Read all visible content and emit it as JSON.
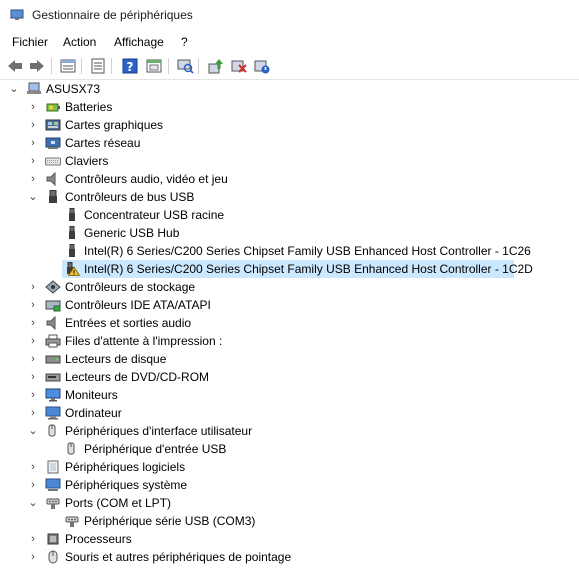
{
  "window": {
    "title": "Gestionnaire de périphériques"
  },
  "menu": [
    "Fichier",
    "Action",
    "Affichage",
    "?"
  ],
  "toolbar": {
    "buttons": [
      "back-icon",
      "forward-icon",
      "properties-view-icon",
      "list-view-icon",
      "help-icon",
      "show-hidden-icon",
      "scan-icon",
      "update-driver-icon",
      "uninstall-icon",
      "disable-device-icon"
    ]
  },
  "colors": {
    "selection": "#cce8ff",
    "warning": "#f2c12e"
  },
  "tree": {
    "root": "ASUSX73",
    "nodes": [
      {
        "label": "Batteries",
        "state": "collapsed",
        "icon": "battery-icon"
      },
      {
        "label": "Cartes graphiques",
        "state": "collapsed",
        "icon": "display-adapter-icon"
      },
      {
        "label": "Cartes réseau",
        "state": "collapsed",
        "icon": "network-adapter-icon"
      },
      {
        "label": "Claviers",
        "state": "collapsed",
        "icon": "keyboard-icon"
      },
      {
        "label": "Contrôleurs audio, vidéo et jeu",
        "state": "collapsed",
        "icon": "speaker-icon"
      },
      {
        "label": "Contrôleurs de bus USB",
        "state": "expanded",
        "icon": "usb-icon",
        "children": [
          {
            "label": "Concentrateur USB racine",
            "icon": "usb-plug-icon"
          },
          {
            "label": "Generic USB Hub",
            "icon": "usb-plug-icon"
          },
          {
            "label": "Intel(R) 6 Series/C200 Series Chipset Family USB Enhanced Host Controller - 1C26",
            "icon": "usb-plug-icon"
          },
          {
            "label": "Intel(R) 6 Series/C200 Series Chipset Family USB Enhanced Host Controller - 1C2D",
            "icon": "usb-warning-icon",
            "selected": true
          }
        ]
      },
      {
        "label": "Contrôleurs de stockage",
        "state": "collapsed",
        "icon": "storage-controller-icon"
      },
      {
        "label": "Contrôleurs IDE ATA/ATAPI",
        "state": "collapsed",
        "icon": "ide-controller-icon"
      },
      {
        "label": "Entrées et sorties audio",
        "state": "collapsed",
        "icon": "audio-io-icon"
      },
      {
        "label": "Files d'attente à l'impression :",
        "state": "collapsed",
        "icon": "printer-icon"
      },
      {
        "label": "Lecteurs de disque",
        "state": "collapsed",
        "icon": "disk-drive-icon"
      },
      {
        "label": "Lecteurs de DVD/CD-ROM",
        "state": "collapsed",
        "icon": "dvd-drive-icon"
      },
      {
        "label": "Moniteurs",
        "state": "collapsed",
        "icon": "monitor-icon"
      },
      {
        "label": "Ordinateur",
        "state": "collapsed",
        "icon": "computer-icon"
      },
      {
        "label": "Périphériques d'interface utilisateur",
        "state": "expanded",
        "icon": "hid-icon",
        "children": [
          {
            "label": "Périphérique d'entrée USB",
            "icon": "hid-icon"
          }
        ]
      },
      {
        "label": "Périphériques logiciels",
        "state": "collapsed",
        "icon": "software-device-icon"
      },
      {
        "label": "Périphériques système",
        "state": "collapsed",
        "icon": "system-device-icon"
      },
      {
        "label": "Ports (COM et LPT)",
        "state": "expanded",
        "icon": "port-icon",
        "children": [
          {
            "label": "Périphérique série USB (COM3)",
            "icon": "port-icon"
          }
        ]
      },
      {
        "label": "Processeurs",
        "state": "collapsed",
        "icon": "processor-icon"
      },
      {
        "label": "Souris et autres périphériques de pointage",
        "state": "collapsed",
        "icon": "mouse-icon"
      }
    ]
  }
}
